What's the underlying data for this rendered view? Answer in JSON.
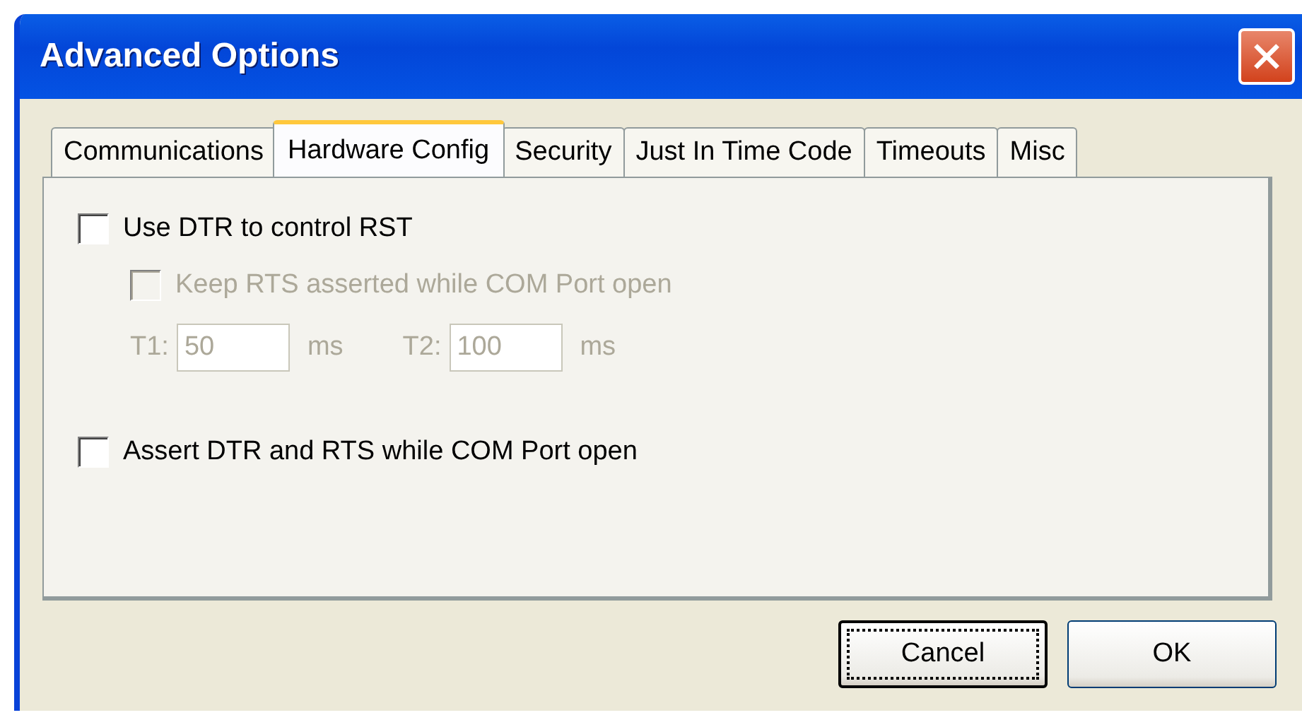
{
  "window": {
    "title": "Advanced Options"
  },
  "tabs": [
    {
      "label": "Communications",
      "selected": false
    },
    {
      "label": "Hardware Config",
      "selected": true
    },
    {
      "label": "Security",
      "selected": false
    },
    {
      "label": "Just In Time Code",
      "selected": false
    },
    {
      "label": "Timeouts",
      "selected": false
    },
    {
      "label": "Misc",
      "selected": false
    }
  ],
  "options": [
    {
      "kind": "checkbox",
      "label": "Use DTR to control RST",
      "checked": false,
      "disabled": false,
      "children": [
        {
          "kind": "checkbox",
          "label": "Keep RTS asserted while COM Port open",
          "checked": false,
          "disabled": true
        },
        {
          "kind": "timings",
          "disabled": true,
          "fields": [
            {
              "label": "T1:",
              "value": "50",
              "unit": "ms"
            },
            {
              "label": "T2:",
              "value": "100",
              "unit": "ms"
            }
          ]
        }
      ]
    },
    {
      "kind": "checkbox",
      "label": "Assert DTR and RTS while COM Port open",
      "checked": false,
      "disabled": false
    }
  ],
  "buttons": [
    {
      "label": "Cancel",
      "focused": true
    },
    {
      "label": "OK",
      "focused": false
    }
  ]
}
